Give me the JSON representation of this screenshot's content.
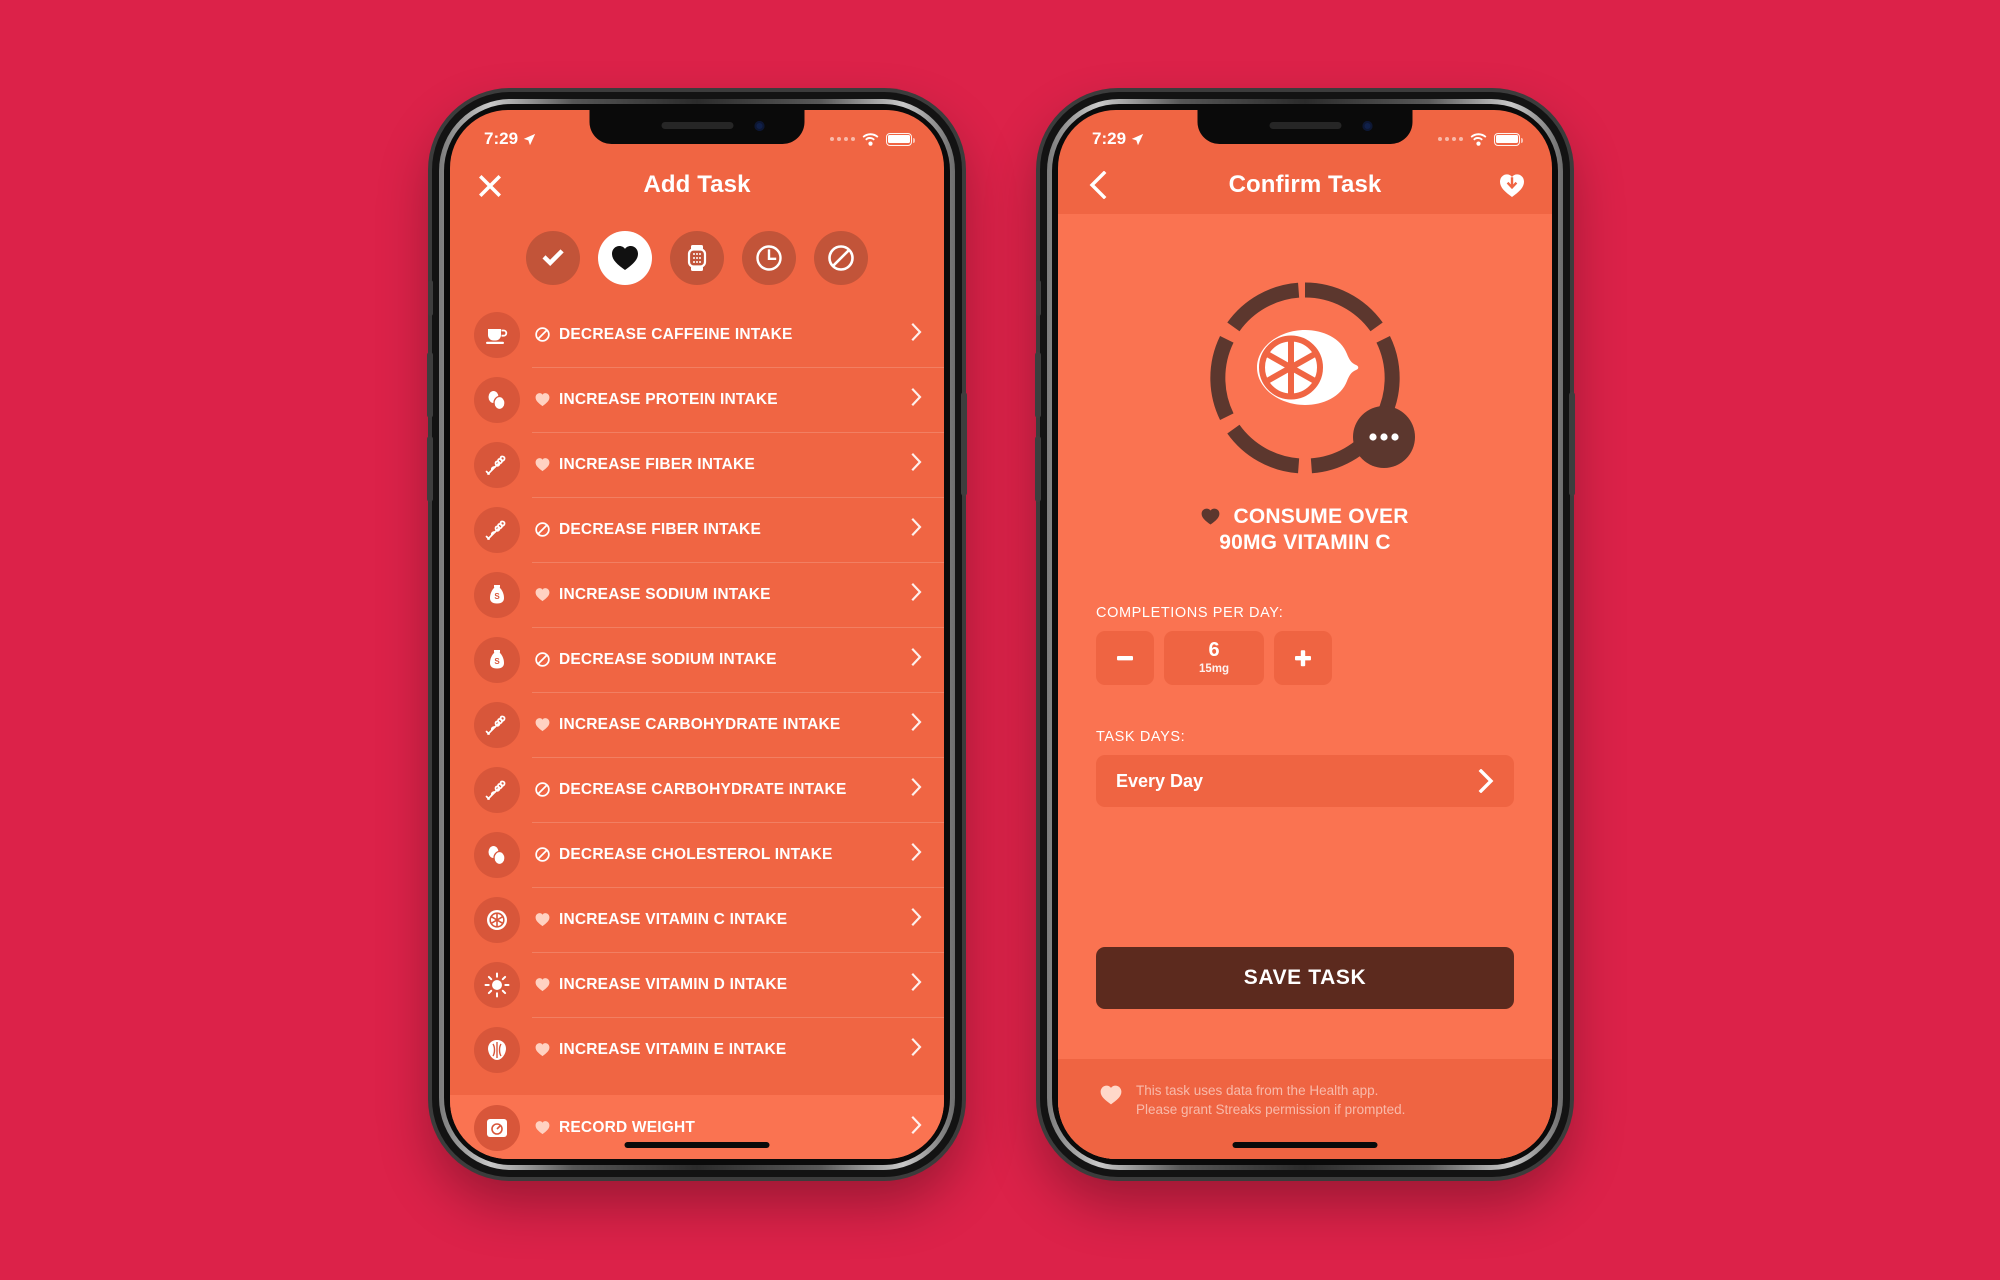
{
  "background_color": "#dc2249",
  "phones": {
    "left": {
      "status_bar": {
        "time": "7:29",
        "location_icon": "location-arrow-icon",
        "wifi_icon": "wifi-icon",
        "battery_icon": "battery-icon"
      },
      "nav": {
        "left_icon": "close-icon",
        "title": "Add Task",
        "right_icon": ""
      },
      "categories": [
        {
          "name": "check-icon",
          "selected": false
        },
        {
          "name": "heart-icon",
          "selected": true
        },
        {
          "name": "watch-icon",
          "selected": false
        },
        {
          "name": "clock-icon",
          "selected": false
        },
        {
          "name": "prohibition-icon",
          "selected": false
        }
      ],
      "tasks": [
        {
          "icon": "coffee-cup-icon",
          "prefix": "prohibition-icon",
          "label": "DECREASE CAFFEINE INTAKE"
        },
        {
          "icon": "eggs-icon",
          "prefix": "heart-icon",
          "label": "INCREASE PROTEIN INTAKE"
        },
        {
          "icon": "wheat-icon",
          "prefix": "heart-icon",
          "label": "INCREASE FIBER INTAKE"
        },
        {
          "icon": "wheat-icon",
          "prefix": "prohibition-icon",
          "label": "DECREASE FIBER INTAKE"
        },
        {
          "icon": "salt-shaker-icon",
          "prefix": "heart-icon",
          "label": "INCREASE SODIUM INTAKE"
        },
        {
          "icon": "salt-shaker-icon",
          "prefix": "prohibition-icon",
          "label": "DECREASE SODIUM INTAKE"
        },
        {
          "icon": "wheat-icon",
          "prefix": "heart-icon",
          "label": "INCREASE CARBOHYDRATE INTAKE"
        },
        {
          "icon": "wheat-icon",
          "prefix": "prohibition-icon",
          "label": "DECREASE CARBOHYDRATE INTAKE"
        },
        {
          "icon": "eggs-icon",
          "prefix": "prohibition-icon",
          "label": "DECREASE CHOLESTEROL INTAKE"
        },
        {
          "icon": "citrus-icon",
          "prefix": "heart-icon",
          "label": "INCREASE VITAMIN C INTAKE"
        },
        {
          "icon": "sun-icon",
          "prefix": "heart-icon",
          "label": "INCREASE VITAMIN D INTAKE"
        },
        {
          "icon": "nut-icon",
          "prefix": "heart-icon",
          "label": "INCREASE VITAMIN E INTAKE"
        },
        {
          "icon": "scale-icon",
          "prefix": "heart-icon",
          "label": "RECORD WEIGHT"
        }
      ]
    },
    "right": {
      "status_bar": {
        "time": "7:29",
        "location_icon": "location-arrow-icon",
        "wifi_icon": "wifi-icon",
        "battery_icon": "battery-icon"
      },
      "nav": {
        "left_icon": "back-chevron-icon",
        "title": "Confirm Task",
        "right_icon": "heart-download-icon"
      },
      "task": {
        "icon": "lemon-icon",
        "ring_segments": 6,
        "options_icon": "ellipsis-icon",
        "prefix_icon": "heart-icon",
        "title_line1": "CONSUME OVER",
        "title_line2": "90MG VITAMIN C"
      },
      "completions": {
        "label": "COMPLETIONS PER DAY:",
        "decrement_icon": "minus-icon",
        "value": "6",
        "unit": "15mg",
        "increment_icon": "plus-icon"
      },
      "task_days": {
        "label": "TASK DAYS:",
        "value": "Every Day",
        "chevron_icon": "chevron-right-icon"
      },
      "save_button": "SAVE TASK",
      "footnote": {
        "icon": "heart-icon",
        "line1": "This task uses data from the Health app.",
        "line2": "Please grant Streaks permission if prompted."
      }
    }
  }
}
